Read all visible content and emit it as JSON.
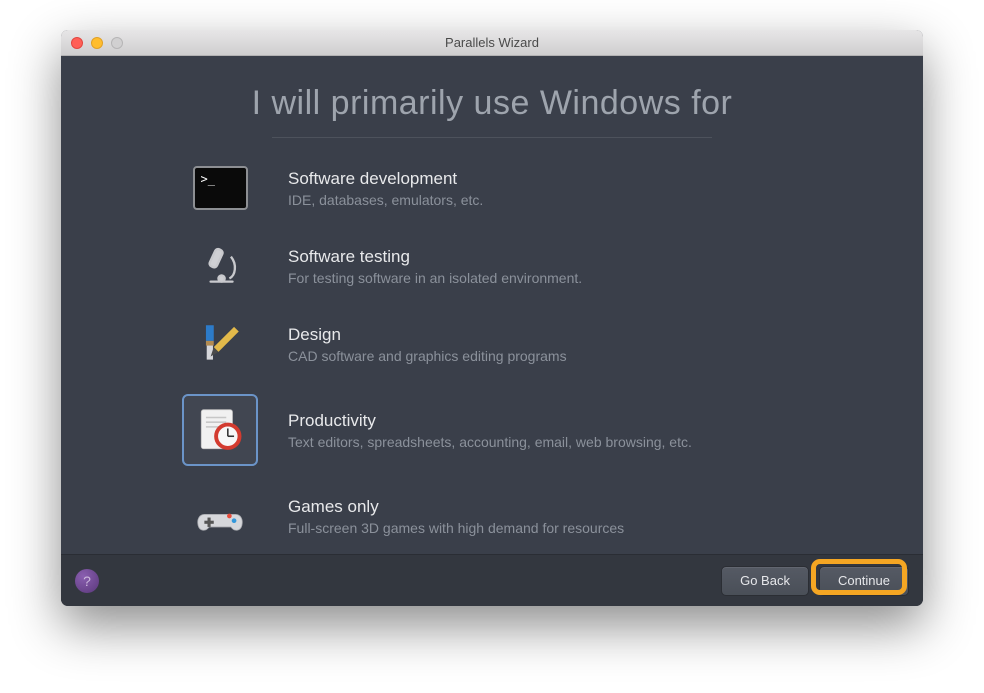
{
  "window": {
    "title": "Parallels Wizard"
  },
  "heading": "I will primarily use Windows for",
  "options": [
    {
      "id": "software-development",
      "title": "Software development",
      "desc": "IDE, databases, emulators, etc.",
      "icon": "terminal-icon",
      "selected": false
    },
    {
      "id": "software-testing",
      "title": "Software testing",
      "desc": "For testing software in an isolated environment.",
      "icon": "microscope-icon",
      "selected": false
    },
    {
      "id": "design",
      "title": "Design",
      "desc": "CAD software and graphics editing programs",
      "icon": "design-tools-icon",
      "selected": false
    },
    {
      "id": "productivity",
      "title": "Productivity",
      "desc": "Text editors, spreadsheets, accounting, email, web browsing, etc.",
      "icon": "productivity-clock-icon",
      "selected": true
    },
    {
      "id": "games-only",
      "title": "Games only",
      "desc": "Full-screen 3D games with high demand for resources",
      "icon": "game-controller-icon",
      "selected": false
    }
  ],
  "footer": {
    "help_label": "?",
    "go_back_label": "Go Back",
    "continue_label": "Continue"
  },
  "highlight": "continue-button"
}
